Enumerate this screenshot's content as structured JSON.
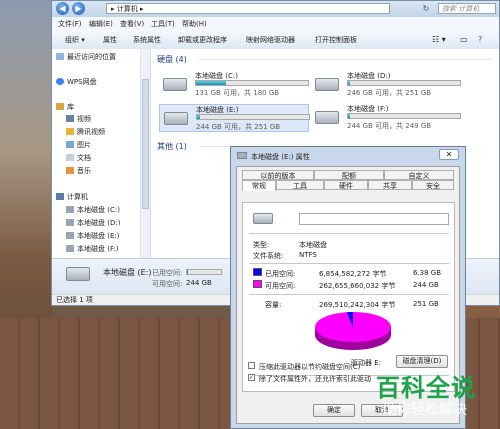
{
  "explorer": {
    "address": "▸ 计算机 ▸",
    "search_placeholder": "搜索 计算机",
    "menu": [
      "文件(F)",
      "编辑(E)",
      "查看(V)",
      "工具(T)",
      "帮助(H)"
    ],
    "toolbar": [
      "组织 ▾",
      "属性",
      "系统属性",
      "卸载或更改程序",
      "映射网络驱动器",
      "打开控制面板"
    ],
    "nav": {
      "recent": "最近访问的位置",
      "wps": "WPS网盘",
      "library": "库",
      "video": "视频",
      "tencent_video": "腾讯视频",
      "pictures": "图片",
      "documents": "文档",
      "music": "音乐",
      "computer": "计算机",
      "drives": [
        "本地磁盘 (C:)",
        "本地磁盘 (D:)",
        "本地磁盘 (E:)",
        "本地磁盘 (F:)"
      ]
    },
    "hard_disks_header": "硬盘 (4)",
    "other_header": "其他 (1)",
    "drives": [
      {
        "name": "本地磁盘 (C:)",
        "info": "131 GB 可用，共 180 GB",
        "used_fraction": 0.27
      },
      {
        "name": "本地磁盘 (D:)",
        "info": "246 GB 可用，共 251 GB",
        "used_fraction": 0.02
      },
      {
        "name": "本地磁盘 (E:)",
        "info": "244 GB 可用，共 251 GB",
        "used_fraction": 0.03
      },
      {
        "name": "本地磁盘 (F:)",
        "info": "244 GB 可用，共 249 GB",
        "used_fraction": 0.02
      }
    ],
    "details": {
      "name": "本地磁盘 (E:)",
      "used_label": "已用空间:",
      "free_label": "可用空间:",
      "free_value": "244 GB"
    },
    "status": "已选择 1 项"
  },
  "dialog": {
    "title": "本地磁盘 (E:) 属性",
    "tabs_row1": [
      "以前的版本",
      "配额",
      "自定义"
    ],
    "tabs_row2": [
      "常规",
      "工具",
      "硬件",
      "共享",
      "安全"
    ],
    "type_label": "类型:",
    "type_value": "本地磁盘",
    "fs_label": "文件系统:",
    "fs_value": "NTFS",
    "used_label": "已用空间:",
    "used_bytes": "6,854,582,272 字节",
    "used_gb": "6.38 GB",
    "free_label": "可用空间:",
    "free_bytes": "262,655,660,032 字节",
    "free_gb": "244 GB",
    "cap_label": "容量:",
    "cap_bytes": "269,510,242,304 字节",
    "cap_gb": "251 GB",
    "drive_label": "驱动器 E:",
    "cleanup_button": "磁盘清理(D)",
    "compress_label": "压缩此驱动器以节约磁盘空间(C)",
    "index_label": "除了文件属性外，还允许索引此驱动",
    "ok_button": "确定",
    "cancel_button": "取消",
    "colors": {
      "used": "#0000ff",
      "free": "#ff00ff"
    }
  },
  "watermark": {
    "line1": "百科全说",
    "line2": "助你轻松解决"
  }
}
